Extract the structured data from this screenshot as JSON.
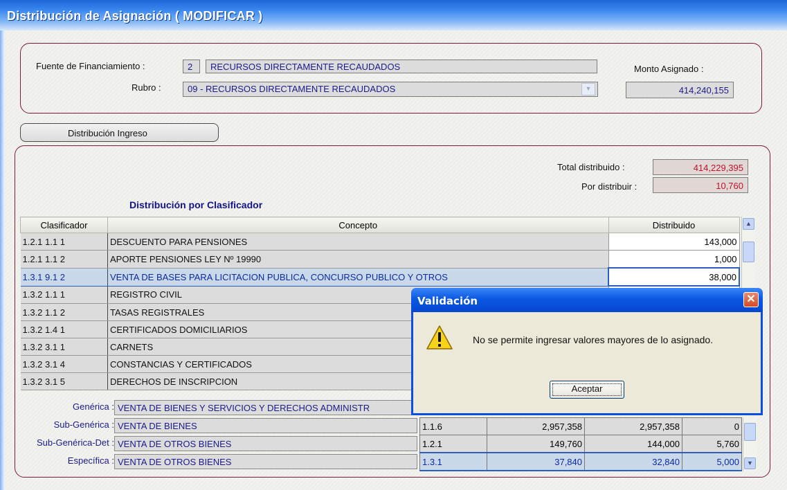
{
  "window": {
    "title": "Distribución de Asignación ( MODIFICAR )"
  },
  "financing": {
    "fuente_label": "Fuente de Financiamiento :",
    "fuente_code": "2",
    "fuente_name": "RECURSOS DIRECTAMENTE RECAUDADOS",
    "rubro_label": "Rubro :",
    "rubro_value": "09 - RECURSOS DIRECTAMENTE RECAUDADOS",
    "monto_label": "Monto Asignado :",
    "monto_value": "414,240,155"
  },
  "tab": {
    "label": "Distribución Ingreso"
  },
  "totals": {
    "total_label": "Total distribuido :",
    "total_value": "414,229,395",
    "por_label": "Por distribuir :",
    "por_value": "10,760"
  },
  "grid": {
    "heading": "Distribución por Clasificador",
    "headers": [
      "Clasificador",
      "Concepto",
      "Distribuido"
    ],
    "rows": [
      {
        "clasificador": "1.2.1  1.1  1",
        "concepto": "DESCUENTO PARA PENSIONES",
        "distribuido": "143,000"
      },
      {
        "clasificador": "1.2.1  1.1  2",
        "concepto": "APORTE PENSIONES LEY Nº 19990",
        "distribuido": "1,000"
      },
      {
        "clasificador": "1.3.1  9.1  2",
        "concepto": "VENTA DE BASES PARA LICITACION PUBLICA, CONCURSO PUBLICO Y  OTROS",
        "distribuido": "38,000"
      },
      {
        "clasificador": "1.3.2  1.1  1",
        "concepto": "REGISTRO CIVIL",
        "distribuido": ""
      },
      {
        "clasificador": "1.3.2  1.1  2",
        "concepto": "TASAS REGISTRALES",
        "distribuido": ""
      },
      {
        "clasificador": "1.3.2  1.4  1",
        "concepto": "CERTIFICADOS DOMICILIARIOS",
        "distribuido": ""
      },
      {
        "clasificador": "1.3.2  3.1  1",
        "concepto": "CARNETS",
        "distribuido": ""
      },
      {
        "clasificador": "1.3.2  3.1  4",
        "concepto": "CONSTANCIAS Y CERTIFICADOS",
        "distribuido": ""
      },
      {
        "clasificador": "1.3.2  3.1  5",
        "concepto": "DERECHOS DE INSCRIPCION",
        "distribuido": ""
      }
    ]
  },
  "detail": {
    "generica_label": "Genérica :",
    "generica_value": "VENTA DE BIENES Y SERVICIOS Y DERECHOS ADMINISTR",
    "subgenerica_label": "Sub-Genérica :",
    "subgenerica_value": "VENTA DE BIENES",
    "subgendet_label": "Sub-Genérica-Det :",
    "subgendet_value": "VENTA DE OTROS BIENES",
    "especifica_label": "Específica :",
    "especifica_value": "VENTA DE OTROS BIENES"
  },
  "summary": {
    "rows": [
      {
        "code": "1.1.6",
        "a": "2,957,358",
        "b": "2,957,358",
        "c": "0"
      },
      {
        "code": "1.2.1",
        "a": "149,760",
        "b": "144,000",
        "c": "5,760"
      },
      {
        "code": "1.3.1",
        "a": "37,840",
        "b": "32,840",
        "c": "5,000"
      }
    ]
  },
  "dialog": {
    "title": "Validación",
    "message": "No se permite ingresar valores mayores de lo asignado.",
    "ok_label": "Aceptar",
    "icon": "warning-icon"
  }
}
